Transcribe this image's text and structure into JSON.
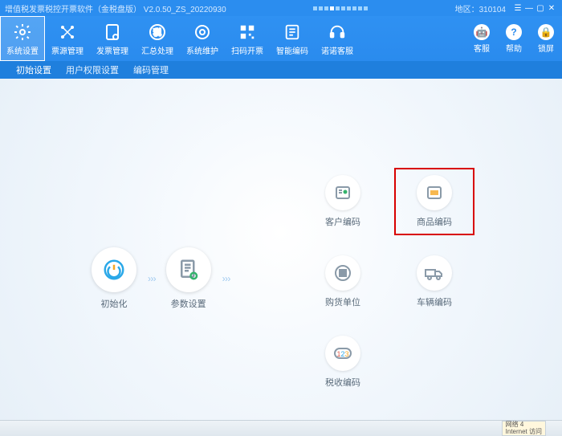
{
  "titlebar": {
    "title": "增值税发票税控开票软件（金税盘版） V2.0.50_ZS_20220930",
    "region_label": "地区：",
    "region_value": "310104"
  },
  "toolbar": {
    "items": [
      {
        "label": "系统设置",
        "icon": "gear"
      },
      {
        "label": "票源管理",
        "icon": "nodes"
      },
      {
        "label": "发票管理",
        "icon": "doc-gear"
      },
      {
        "label": "汇总处理",
        "icon": "sum-badge"
      },
      {
        "label": "系统维护",
        "icon": "wrench-gear"
      },
      {
        "label": "扫码开票",
        "icon": "qrcode"
      },
      {
        "label": "智能编码",
        "icon": "barcode-doc"
      },
      {
        "label": "诺诺客服",
        "icon": "headset"
      }
    ],
    "right": [
      {
        "label": "客服",
        "glyph": "🎧"
      },
      {
        "label": "帮助",
        "glyph": "?"
      },
      {
        "label": "锁屏",
        "glyph": "🔒"
      }
    ]
  },
  "submenu": {
    "items": [
      "初始设置",
      "用户权限设置",
      "编码管理"
    ],
    "active": 0
  },
  "flow": {
    "items": [
      {
        "label": "初始化",
        "icon": "power"
      },
      {
        "label": "参数设置",
        "icon": "doc-cog"
      }
    ]
  },
  "arrows": {
    "glyph": "› › ›"
  },
  "grid": {
    "cells": [
      {
        "label": "客户编码",
        "icon": "person-card"
      },
      {
        "label": "商品编码",
        "icon": "barcode"
      },
      {
        "label": "购货单位",
        "icon": "list-grid"
      },
      {
        "label": "车辆编码",
        "icon": "truck"
      },
      {
        "label": "税收编码",
        "icon": "digits"
      }
    ],
    "highlight_index": 1
  },
  "taskbar": {
    "net_line1": "网络  4",
    "net_line2": "Internet 访问"
  }
}
